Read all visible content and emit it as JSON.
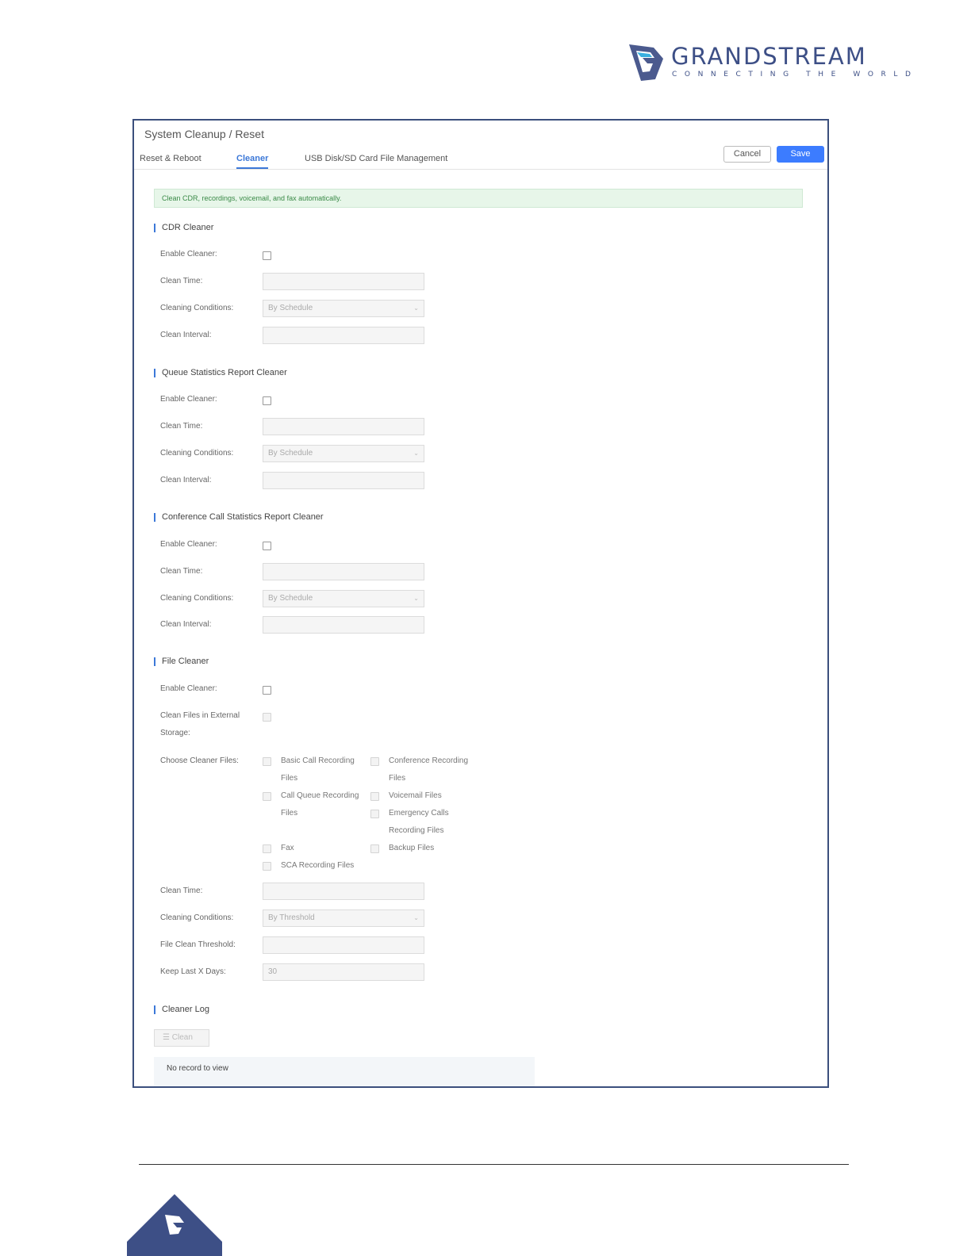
{
  "brand": {
    "name": "GRANDSTREAM",
    "tagline": "CONNECTING THE WORLD",
    "color": "#3d4f86"
  },
  "page": {
    "title": "System Cleanup / Reset",
    "tabs": [
      {
        "label": "Reset & Reboot",
        "active": false
      },
      {
        "label": "Cleaner",
        "active": true
      },
      {
        "label": "USB Disk/SD Card File Management",
        "active": false
      }
    ],
    "cancel": "Cancel",
    "save": "Save",
    "notice": "Clean CDR, recordings, voicemail, and fax automatically."
  },
  "cdr": {
    "title": "CDR Cleaner",
    "enable": "Enable Cleaner:",
    "clean_time": "Clean Time:",
    "conditions": "Cleaning Conditions:",
    "conditions_value": "By Schedule",
    "interval": "Clean Interval:"
  },
  "queue": {
    "title": "Queue Statistics Report Cleaner",
    "enable": "Enable Cleaner:",
    "clean_time": "Clean Time:",
    "conditions": "Cleaning Conditions:",
    "conditions_value": "By Schedule",
    "interval": "Clean Interval:"
  },
  "conference": {
    "title": "Conference Call Statistics Report Cleaner",
    "enable": "Enable Cleaner:",
    "clean_time": "Clean Time:",
    "conditions": "Cleaning Conditions:",
    "conditions_value": "By Schedule",
    "interval": "Clean Interval:"
  },
  "file": {
    "title": "File Cleaner",
    "enable": "Enable Cleaner:",
    "external_1": "Clean Files in External",
    "external_2": "Storage:",
    "choose": "Choose Cleaner Files:",
    "opt_basic_1": "Basic Call Recording",
    "opt_basic_2": "Files",
    "opt_conf_1": "Conference Recording",
    "opt_conf_2": "Files",
    "opt_queue_1": "Call Queue Recording",
    "opt_queue_2": "Files",
    "opt_voicemail": "Voicemail Files",
    "opt_emerg_1": "Emergency Calls",
    "opt_emerg_2": "Recording Files",
    "opt_fax": "Fax",
    "opt_backup": "Backup Files",
    "opt_sca": "SCA Recording Files",
    "clean_time": "Clean Time:",
    "conditions": "Cleaning Conditions:",
    "conditions_value": "By Threshold",
    "threshold": "File Clean Threshold:",
    "keep_days": "Keep Last X Days:",
    "keep_days_value": "30"
  },
  "log": {
    "title": "Cleaner Log",
    "clean_button": "Clean",
    "empty": "No record to view"
  }
}
